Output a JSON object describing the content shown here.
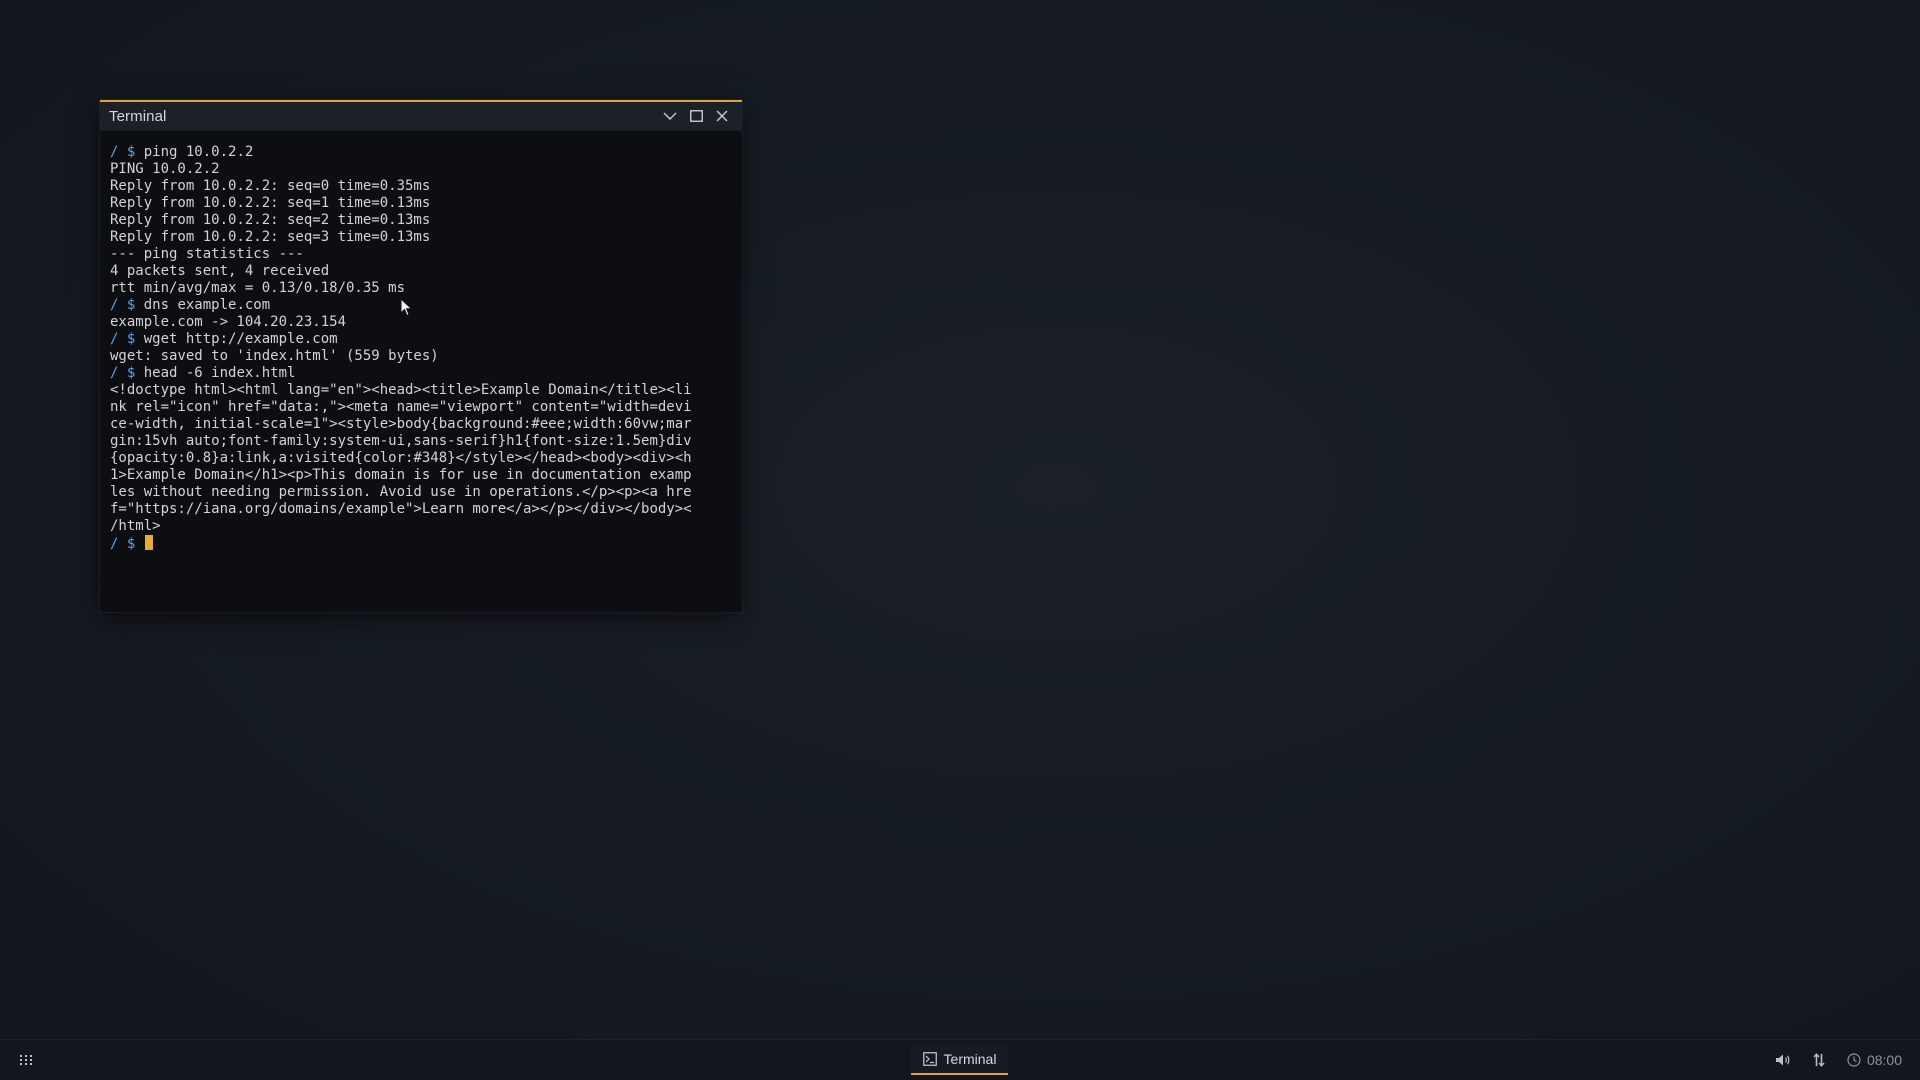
{
  "window": {
    "title": "Terminal",
    "controls": {
      "minimize_icon": "chevron-down-icon",
      "maximize_icon": "maximize-icon",
      "close_icon": "close-icon"
    }
  },
  "terminal": {
    "prompt": "/ $",
    "lines": [
      {
        "prompt": "/ $",
        "text": " ping 10.0.2.2"
      },
      {
        "prompt": "",
        "text": "PING 10.0.2.2"
      },
      {
        "prompt": "",
        "text": "Reply from 10.0.2.2: seq=0 time=0.35ms"
      },
      {
        "prompt": "",
        "text": "Reply from 10.0.2.2: seq=1 time=0.13ms"
      },
      {
        "prompt": "",
        "text": "Reply from 10.0.2.2: seq=2 time=0.13ms"
      },
      {
        "prompt": "",
        "text": "Reply from 10.0.2.2: seq=3 time=0.13ms"
      },
      {
        "prompt": "",
        "text": "--- ping statistics ---"
      },
      {
        "prompt": "",
        "text": "4 packets sent, 4 received"
      },
      {
        "prompt": "",
        "text": "rtt min/avg/max = 0.13/0.18/0.35 ms"
      },
      {
        "prompt": "/ $",
        "text": " dns example.com"
      },
      {
        "prompt": "",
        "text": "example.com -> 104.20.23.154"
      },
      {
        "prompt": "/ $",
        "text": " wget http://example.com"
      },
      {
        "prompt": "",
        "text": "wget: saved to 'index.html' (559 bytes)"
      },
      {
        "prompt": "/ $",
        "text": " head -6 index.html"
      },
      {
        "prompt": "",
        "text": "<!doctype html><html lang=\"en\"><head><title>Example Domain</title><li"
      },
      {
        "prompt": "",
        "text": "nk rel=\"icon\" href=\"data:,\"><meta name=\"viewport\" content=\"width=devi"
      },
      {
        "prompt": "",
        "text": "ce-width, initial-scale=1\"><style>body{background:#eee;width:60vw;mar"
      },
      {
        "prompt": "",
        "text": "gin:15vh auto;font-family:system-ui,sans-serif}h1{font-size:1.5em}div"
      },
      {
        "prompt": "",
        "text": "{opacity:0.8}a:link,a:visited{color:#348}</style></head><body><div><h"
      },
      {
        "prompt": "",
        "text": "1>Example Domain</h1><p>This domain is for use in documentation examp"
      },
      {
        "prompt": "",
        "text": "les without needing permission. Avoid use in operations.</p><p><a hre"
      },
      {
        "prompt": "",
        "text": "f=\"https://iana.org/domains/example\">Learn more</a></p></div></body><"
      },
      {
        "prompt": "",
        "text": "/html>"
      }
    ],
    "current_input": ""
  },
  "taskbar": {
    "launcher_icon": "app-grid-icon",
    "task_label": "Terminal",
    "task_icon": "terminal-icon",
    "tray": {
      "volume_icon": "volume-icon",
      "network_icon": "network-arrows-icon",
      "clock_icon": "clock-icon",
      "time": "08:00"
    }
  },
  "colors": {
    "accent": "#e0a73c",
    "prompt": "#5aa3e8",
    "terminal_bg": "#0c0e12",
    "text": "#d0d3d8"
  }
}
